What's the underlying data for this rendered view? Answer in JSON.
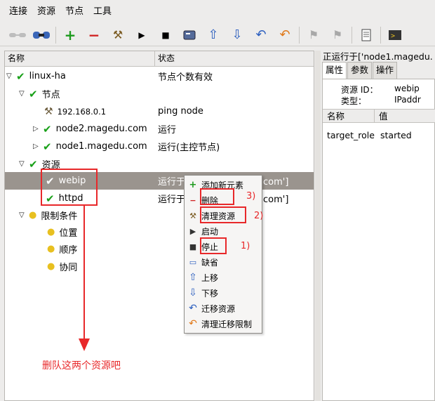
{
  "menubar": [
    "连接",
    "资源",
    "节点",
    "工具"
  ],
  "tree_header": {
    "col_name": "名称",
    "col_status": "状态"
  },
  "tree": {
    "root": {
      "name": "linux-ha",
      "status": "节点个数有效"
    },
    "nodes_group": {
      "name": "节点"
    },
    "node_ip": {
      "name": "192.168.0.1",
      "status": "ping node"
    },
    "node2": {
      "name": "node2.magedu.com",
      "status": "运行"
    },
    "node1": {
      "name": "node1.magedu.com",
      "status": "运行(主控节点)"
    },
    "resources_group": {
      "name": "资源"
    },
    "webip": {
      "name": "webip",
      "status": "运行于['node1.magedu.com']"
    },
    "httpd": {
      "name": "httpd",
      "status": "运行于['node1.magedu.com']"
    },
    "constraints_group": {
      "name": "限制条件"
    },
    "location": {
      "name": "位置"
    },
    "order": {
      "name": "顺序"
    },
    "colocation": {
      "name": "协同"
    }
  },
  "right_panel": {
    "title": "正运行于['node1.magedu.",
    "tabs": [
      "属性",
      "参数",
      "操作"
    ],
    "resource_id_label": "资源 ID：",
    "resource_id_value": "webip",
    "type_label": "类型：",
    "type_value": "IPaddr",
    "props_header": {
      "name": "名称",
      "value": "值"
    },
    "prop_row": {
      "name": "target_role",
      "value": "started"
    }
  },
  "context_menu": {
    "items": [
      {
        "label": "添加新元素",
        "icon": "plus-icon"
      },
      {
        "label": "删除",
        "icon": "minus-icon"
      },
      {
        "label": "清理资源",
        "icon": "broom-icon"
      },
      {
        "label": "启动",
        "icon": "play-icon"
      },
      {
        "label": "停止",
        "icon": "stop-icon"
      },
      {
        "label": "缺省",
        "icon": "default-icon"
      },
      {
        "label": "上移",
        "icon": "arrow-up-icon"
      },
      {
        "label": "下移",
        "icon": "arrow-down-icon"
      },
      {
        "label": "迁移资源",
        "icon": "migrate-icon"
      },
      {
        "label": "清理迁移限制",
        "icon": "undo-migrate-icon"
      }
    ]
  },
  "annotations": {
    "step1": "1)",
    "step2": "2)",
    "step3": "3)",
    "note": "删队这两个资源吧"
  },
  "colors": {
    "annotation": "#e8282a",
    "selection": "#9a948e",
    "check": "#18a018"
  }
}
